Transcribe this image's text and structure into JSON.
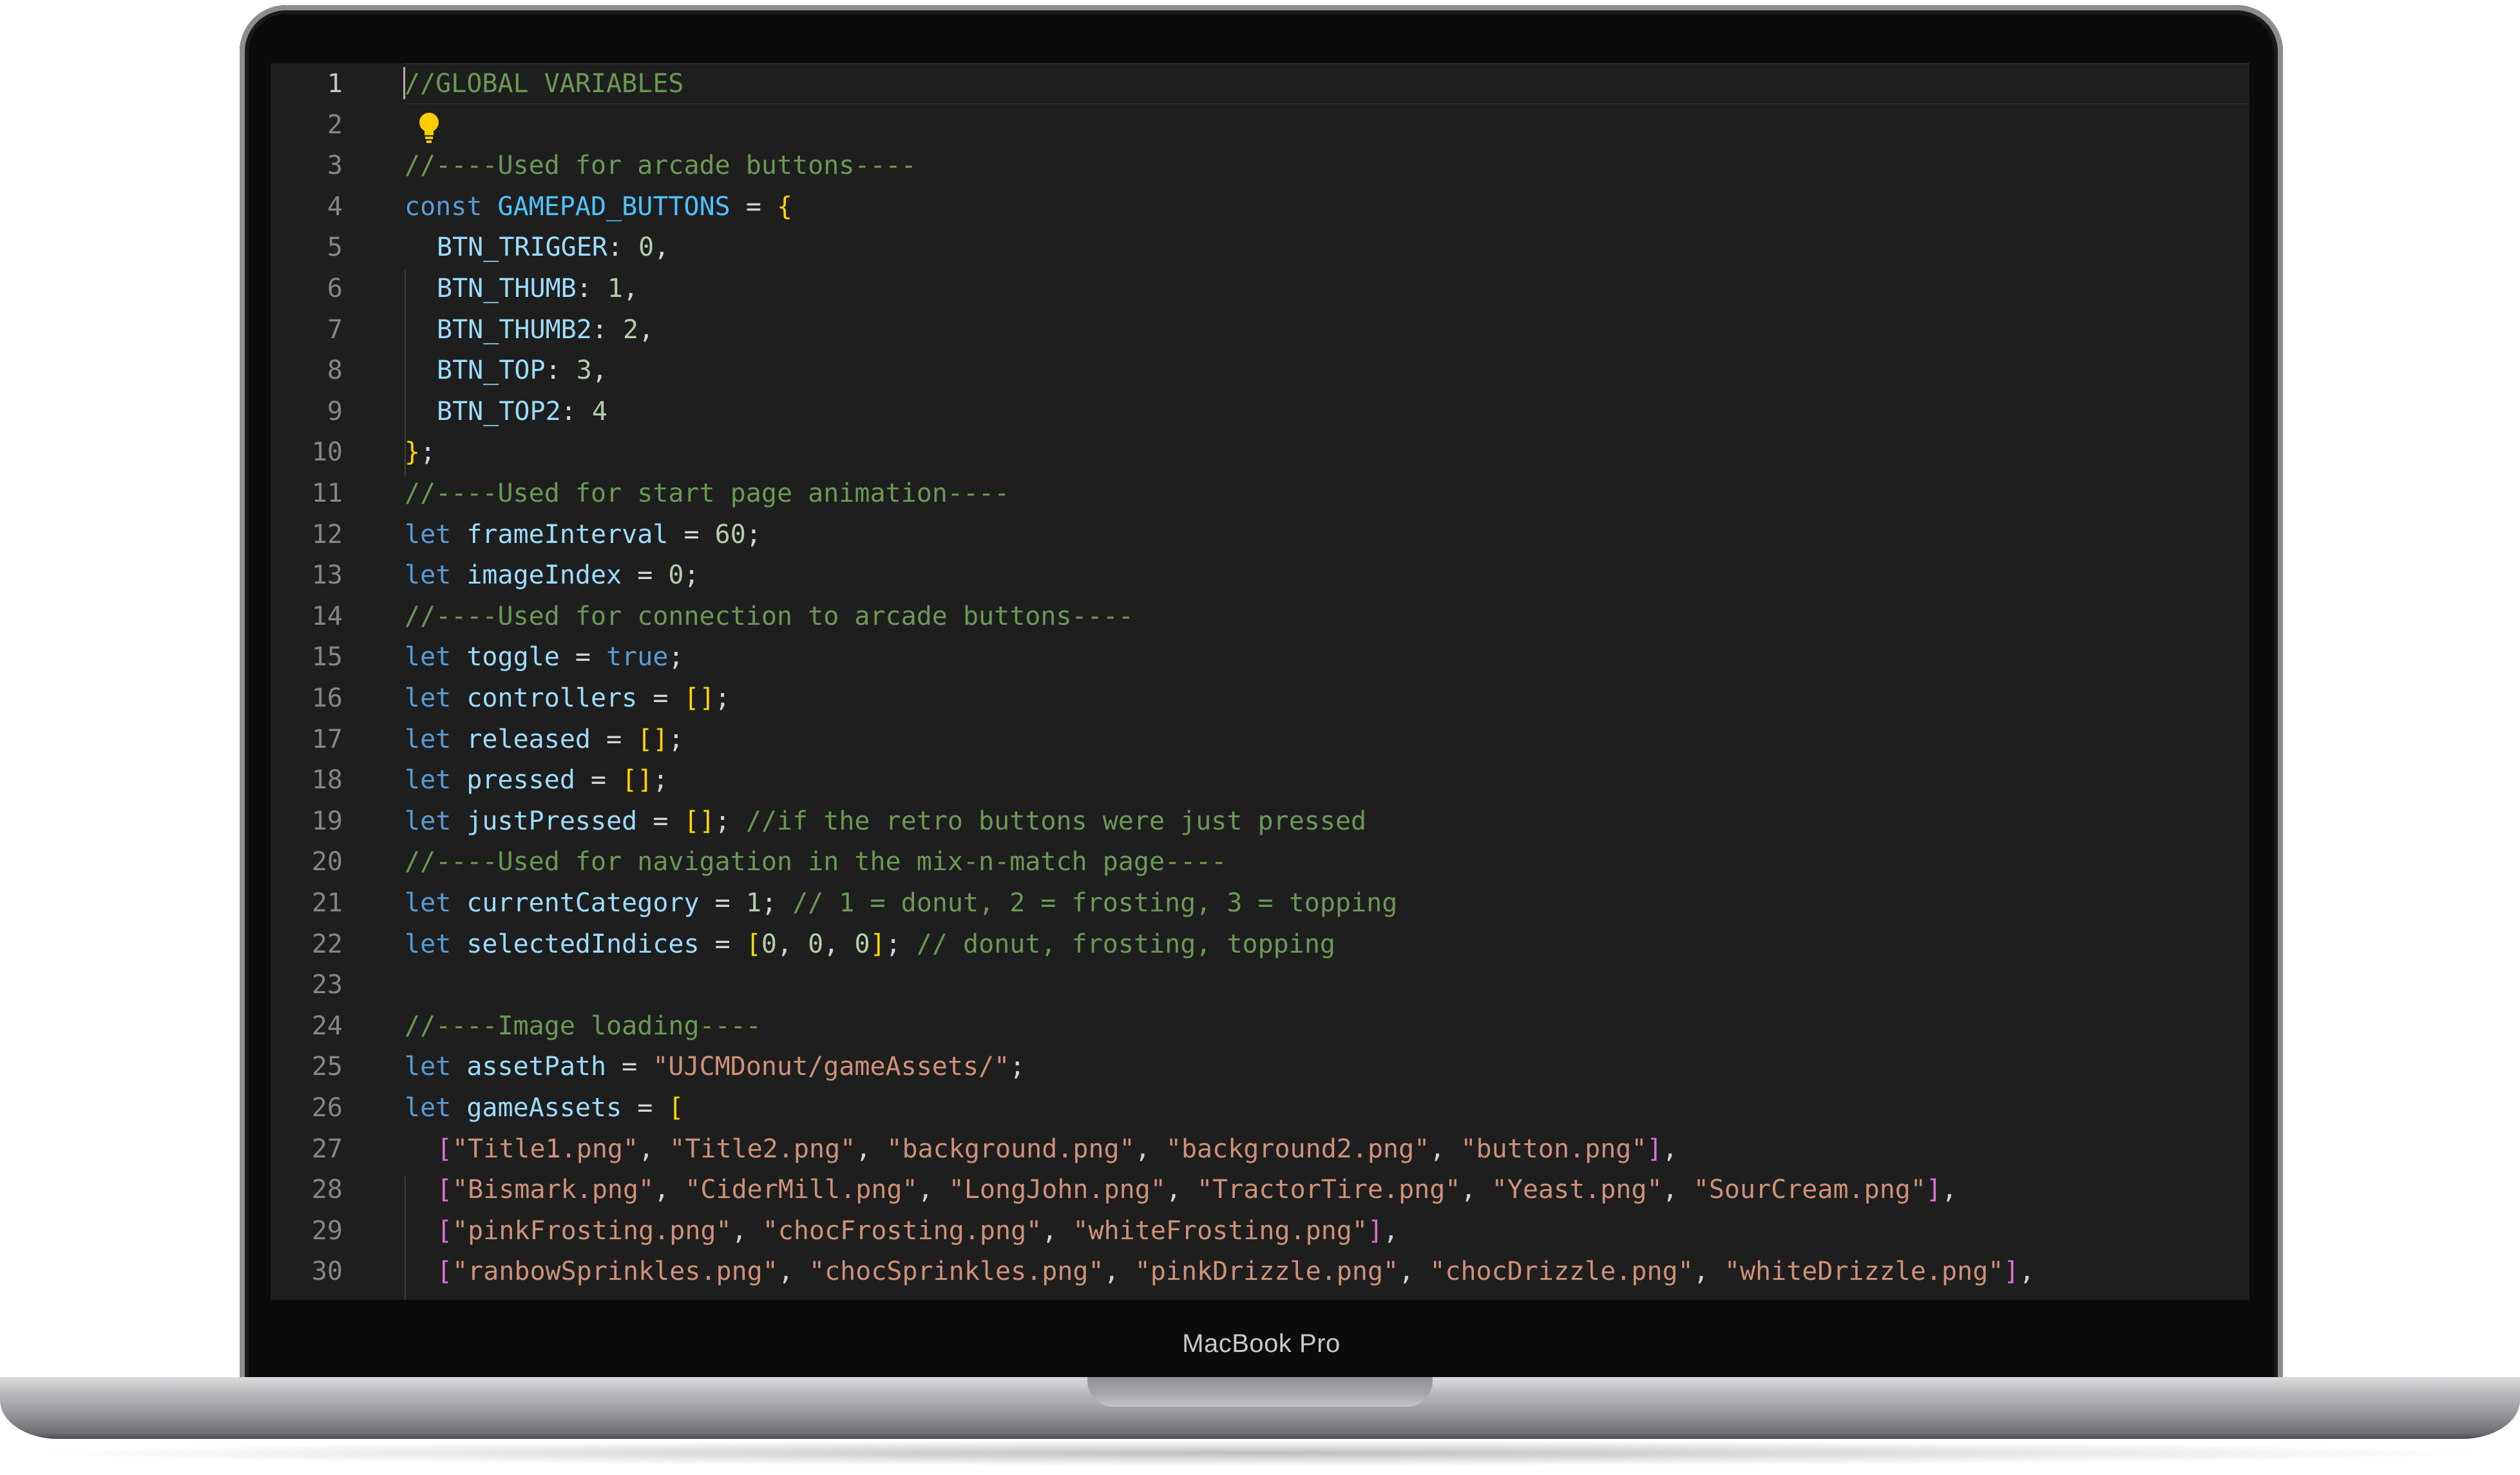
{
  "device": {
    "brand_label": "MacBook Pro"
  },
  "editor": {
    "active_line": 1,
    "lines": [
      {
        "n": "1",
        "tokens": [
          {
            "t": "//GLOBAL VARIABLES",
            "c": "com"
          }
        ]
      },
      {
        "n": "2",
        "tokens": []
      },
      {
        "n": "3",
        "tokens": [
          {
            "t": "//----Used for arcade buttons----",
            "c": "com"
          }
        ]
      },
      {
        "n": "4",
        "tokens": [
          {
            "t": "const ",
            "c": "kw"
          },
          {
            "t": "GAMEPAD_BUTTONS",
            "c": "const"
          },
          {
            "t": " = ",
            "c": "pun"
          },
          {
            "t": "{",
            "c": "b1"
          }
        ]
      },
      {
        "n": "5",
        "indent": 1,
        "tokens": [
          {
            "t": "BTN_TRIGGER",
            "c": "var"
          },
          {
            "t": ": ",
            "c": "pun"
          },
          {
            "t": "0",
            "c": "num"
          },
          {
            "t": ",",
            "c": "pun"
          }
        ]
      },
      {
        "n": "6",
        "indent": 1,
        "tokens": [
          {
            "t": "BTN_THUMB",
            "c": "var"
          },
          {
            "t": ": ",
            "c": "pun"
          },
          {
            "t": "1",
            "c": "num"
          },
          {
            "t": ",",
            "c": "pun"
          }
        ]
      },
      {
        "n": "7",
        "indent": 1,
        "tokens": [
          {
            "t": "BTN_THUMB2",
            "c": "var"
          },
          {
            "t": ": ",
            "c": "pun"
          },
          {
            "t": "2",
            "c": "num"
          },
          {
            "t": ",",
            "c": "pun"
          }
        ]
      },
      {
        "n": "8",
        "indent": 1,
        "tokens": [
          {
            "t": "BTN_TOP",
            "c": "var"
          },
          {
            "t": ": ",
            "c": "pun"
          },
          {
            "t": "3",
            "c": "num"
          },
          {
            "t": ",",
            "c": "pun"
          }
        ]
      },
      {
        "n": "9",
        "indent": 1,
        "tokens": [
          {
            "t": "BTN_TOP2",
            "c": "var"
          },
          {
            "t": ": ",
            "c": "pun"
          },
          {
            "t": "4",
            "c": "num"
          }
        ]
      },
      {
        "n": "10",
        "tokens": [
          {
            "t": "}",
            "c": "b1"
          },
          {
            "t": ";",
            "c": "pun"
          }
        ]
      },
      {
        "n": "11",
        "tokens": [
          {
            "t": "//----Used for start page animation----",
            "c": "com"
          }
        ]
      },
      {
        "n": "12",
        "tokens": [
          {
            "t": "let ",
            "c": "kw"
          },
          {
            "t": "frameInterval",
            "c": "var"
          },
          {
            "t": " = ",
            "c": "pun"
          },
          {
            "t": "60",
            "c": "num"
          },
          {
            "t": ";",
            "c": "pun"
          }
        ]
      },
      {
        "n": "13",
        "tokens": [
          {
            "t": "let ",
            "c": "kw"
          },
          {
            "t": "imageIndex",
            "c": "var"
          },
          {
            "t": " = ",
            "c": "pun"
          },
          {
            "t": "0",
            "c": "num"
          },
          {
            "t": ";",
            "c": "pun"
          }
        ]
      },
      {
        "n": "14",
        "tokens": [
          {
            "t": "//----Used for connection to arcade buttons----",
            "c": "com"
          }
        ]
      },
      {
        "n": "15",
        "tokens": [
          {
            "t": "let ",
            "c": "kw"
          },
          {
            "t": "toggle",
            "c": "var"
          },
          {
            "t": " = ",
            "c": "pun"
          },
          {
            "t": "true",
            "c": "kw"
          },
          {
            "t": ";",
            "c": "pun"
          }
        ]
      },
      {
        "n": "16",
        "tokens": [
          {
            "t": "let ",
            "c": "kw"
          },
          {
            "t": "controllers",
            "c": "var"
          },
          {
            "t": " = ",
            "c": "pun"
          },
          {
            "t": "[]",
            "c": "b1"
          },
          {
            "t": ";",
            "c": "pun"
          }
        ]
      },
      {
        "n": "17",
        "tokens": [
          {
            "t": "let ",
            "c": "kw"
          },
          {
            "t": "released",
            "c": "var"
          },
          {
            "t": " = ",
            "c": "pun"
          },
          {
            "t": "[]",
            "c": "b1"
          },
          {
            "t": ";",
            "c": "pun"
          }
        ]
      },
      {
        "n": "18",
        "tokens": [
          {
            "t": "let ",
            "c": "kw"
          },
          {
            "t": "pressed",
            "c": "var"
          },
          {
            "t": " = ",
            "c": "pun"
          },
          {
            "t": "[]",
            "c": "b1"
          },
          {
            "t": ";",
            "c": "pun"
          }
        ]
      },
      {
        "n": "19",
        "tokens": [
          {
            "t": "let ",
            "c": "kw"
          },
          {
            "t": "justPressed",
            "c": "var"
          },
          {
            "t": " = ",
            "c": "pun"
          },
          {
            "t": "[]",
            "c": "b1"
          },
          {
            "t": "; ",
            "c": "pun"
          },
          {
            "t": "//if the retro buttons were just pressed",
            "c": "com"
          }
        ]
      },
      {
        "n": "20",
        "tokens": [
          {
            "t": "//----Used for navigation in the mix-n-match page----",
            "c": "com"
          }
        ]
      },
      {
        "n": "21",
        "tokens": [
          {
            "t": "let ",
            "c": "kw"
          },
          {
            "t": "currentCategory",
            "c": "var"
          },
          {
            "t": " = ",
            "c": "pun"
          },
          {
            "t": "1",
            "c": "num"
          },
          {
            "t": "; ",
            "c": "pun"
          },
          {
            "t": "// 1 = donut, 2 = frosting, 3 = topping",
            "c": "com"
          }
        ]
      },
      {
        "n": "22",
        "tokens": [
          {
            "t": "let ",
            "c": "kw"
          },
          {
            "t": "selectedIndices",
            "c": "var"
          },
          {
            "t": " = ",
            "c": "pun"
          },
          {
            "t": "[",
            "c": "b1"
          },
          {
            "t": "0",
            "c": "num"
          },
          {
            "t": ", ",
            "c": "pun"
          },
          {
            "t": "0",
            "c": "num"
          },
          {
            "t": ", ",
            "c": "pun"
          },
          {
            "t": "0",
            "c": "num"
          },
          {
            "t": "]",
            "c": "b1"
          },
          {
            "t": "; ",
            "c": "pun"
          },
          {
            "t": "// donut, frosting, topping",
            "c": "com"
          }
        ]
      },
      {
        "n": "23",
        "tokens": []
      },
      {
        "n": "24",
        "tokens": [
          {
            "t": "//----Image loading----",
            "c": "com"
          }
        ]
      },
      {
        "n": "25",
        "tokens": [
          {
            "t": "let ",
            "c": "kw"
          },
          {
            "t": "assetPath",
            "c": "var"
          },
          {
            "t": " = ",
            "c": "pun"
          },
          {
            "t": "\"UJCMDonut/gameAssets/\"",
            "c": "str"
          },
          {
            "t": ";",
            "c": "pun"
          }
        ]
      },
      {
        "n": "26",
        "tokens": [
          {
            "t": "let ",
            "c": "kw"
          },
          {
            "t": "gameAssets",
            "c": "var"
          },
          {
            "t": " = ",
            "c": "pun"
          },
          {
            "t": "[",
            "c": "b1"
          }
        ]
      },
      {
        "n": "27",
        "indent": 1,
        "tokens": [
          {
            "t": "[",
            "c": "b2"
          },
          {
            "t": "\"Title1.png\"",
            "c": "str"
          },
          {
            "t": ", ",
            "c": "pun"
          },
          {
            "t": "\"Title2.png\"",
            "c": "str"
          },
          {
            "t": ", ",
            "c": "pun"
          },
          {
            "t": "\"background.png\"",
            "c": "str"
          },
          {
            "t": ", ",
            "c": "pun"
          },
          {
            "t": "\"background2.png\"",
            "c": "str"
          },
          {
            "t": ", ",
            "c": "pun"
          },
          {
            "t": "\"button.png\"",
            "c": "str"
          },
          {
            "t": "]",
            "c": "b2"
          },
          {
            "t": ",",
            "c": "pun"
          }
        ]
      },
      {
        "n": "28",
        "indent": 1,
        "tokens": [
          {
            "t": "[",
            "c": "b2"
          },
          {
            "t": "\"Bismark.png\"",
            "c": "str"
          },
          {
            "t": ", ",
            "c": "pun"
          },
          {
            "t": "\"CiderMill.png\"",
            "c": "str"
          },
          {
            "t": ", ",
            "c": "pun"
          },
          {
            "t": "\"LongJohn.png\"",
            "c": "str"
          },
          {
            "t": ", ",
            "c": "pun"
          },
          {
            "t": "\"TractorTire.png\"",
            "c": "str"
          },
          {
            "t": ", ",
            "c": "pun"
          },
          {
            "t": "\"Yeast.png\"",
            "c": "str"
          },
          {
            "t": ", ",
            "c": "pun"
          },
          {
            "t": "\"SourCream.png\"",
            "c": "str"
          },
          {
            "t": "]",
            "c": "b2"
          },
          {
            "t": ",",
            "c": "pun"
          }
        ]
      },
      {
        "n": "29",
        "indent": 1,
        "tokens": [
          {
            "t": "[",
            "c": "b2"
          },
          {
            "t": "\"pinkFrosting.png\"",
            "c": "str"
          },
          {
            "t": ", ",
            "c": "pun"
          },
          {
            "t": "\"chocFrosting.png\"",
            "c": "str"
          },
          {
            "t": ", ",
            "c": "pun"
          },
          {
            "t": "\"whiteFrosting.png\"",
            "c": "str"
          },
          {
            "t": "]",
            "c": "b2"
          },
          {
            "t": ",",
            "c": "pun"
          }
        ]
      },
      {
        "n": "30",
        "indent": 1,
        "tokens": [
          {
            "t": "[",
            "c": "b2"
          },
          {
            "t": "\"ranbowSprinkles.png\"",
            "c": "str"
          },
          {
            "t": ", ",
            "c": "pun"
          },
          {
            "t": "\"chocSprinkles.png\"",
            "c": "str"
          },
          {
            "t": ", ",
            "c": "pun"
          },
          {
            "t": "\"pinkDrizzle.png\"",
            "c": "str"
          },
          {
            "t": ", ",
            "c": "pun"
          },
          {
            "t": "\"chocDrizzle.png\"",
            "c": "str"
          },
          {
            "t": ", ",
            "c": "pun"
          },
          {
            "t": "\"whiteDrizzle.png\"",
            "c": "str"
          },
          {
            "t": "]",
            "c": "b2"
          },
          {
            "t": ",",
            "c": "pun"
          }
        ]
      }
    ]
  }
}
